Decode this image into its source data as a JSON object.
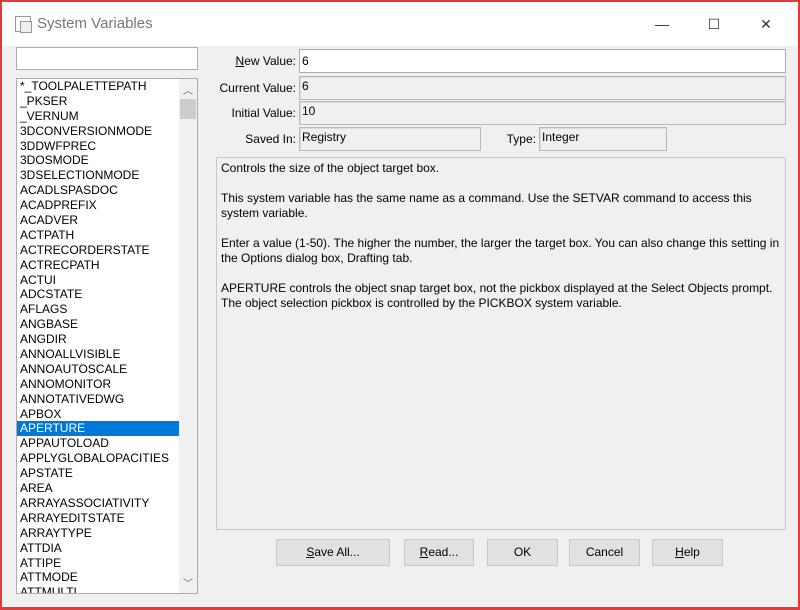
{
  "window": {
    "title": "System Variables",
    "minimize": "—",
    "maximize": "☐",
    "close": "✕"
  },
  "search": {
    "value": ""
  },
  "list": {
    "items": [
      "*_TOOLPALETTEPATH",
      "_PKSER",
      "_VERNUM",
      "3DCONVERSIONMODE",
      "3DDWFPREC",
      "3DOSMODE",
      "3DSELECTIONMODE",
      "ACADLSPASDOC",
      "ACADPREFIX",
      "ACADVER",
      "ACTPATH",
      "ACTRECORDERSTATE",
      "ACTRECPATH",
      "ACTUI",
      "ADCSTATE",
      "AFLAGS",
      "ANGBASE",
      "ANGDIR",
      "ANNOALLVISIBLE",
      "ANNOAUTOSCALE",
      "ANNOMONITOR",
      "ANNOTATIVEDWG",
      "APBOX",
      "APERTURE",
      "APPAUTOLOAD",
      "APPLYGLOBALOPACITIES",
      "APSTATE",
      "AREA",
      "ARRAYASSOCIATIVITY",
      "ARRAYEDITSTATE",
      "ARRAYTYPE",
      "ATTDIA",
      "ATTIPE",
      "ATTMODE",
      "ATTMULTI"
    ],
    "selected": "APERTURE",
    "selected_color": "#0078d7"
  },
  "fields": {
    "new_value": {
      "label_u": "N",
      "label_rest": "ew Value:",
      "value": "6"
    },
    "current_value": {
      "label": "Current Value:",
      "value": "6"
    },
    "initial_value": {
      "label": "Initial Value:",
      "value": "10"
    },
    "saved_in": {
      "label": "Saved In:",
      "value": "Registry"
    },
    "type": {
      "label": "Type:",
      "value": "Integer"
    }
  },
  "description": [
    "Controls the size of the object target box.",
    "This system variable has the same name as a command. Use the SETVAR command to access this system variable.",
    "Enter a value (1-50). The higher the number, the larger the target box. You can also change this setting in the Options dialog box, Drafting tab.",
    "APERTURE controls the object snap target box, not the pickbox displayed at the Select Objects prompt. The object selection pickbox is controlled by the PICKBOX system variable."
  ],
  "buttons": {
    "save_all": {
      "u": "S",
      "rest": "ave All..."
    },
    "read": {
      "u": "R",
      "rest": "ead..."
    },
    "ok": "OK",
    "cancel": "Cancel",
    "help": {
      "u": "H",
      "rest": "elp"
    }
  }
}
